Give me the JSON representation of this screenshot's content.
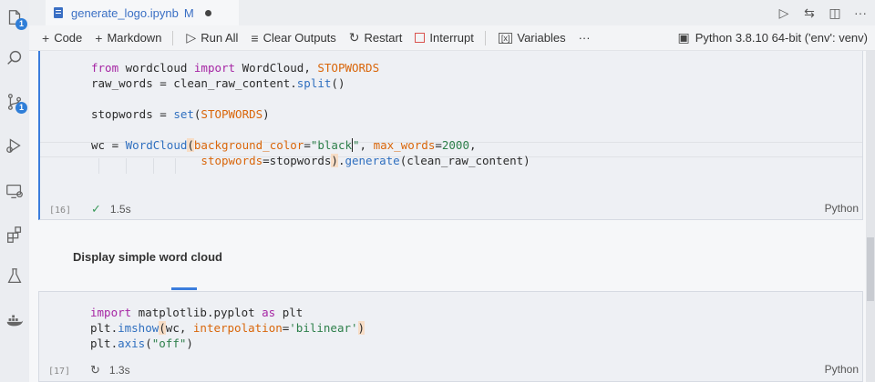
{
  "activity_bar": {
    "explorer_badge": "1",
    "source_control_badge": "1"
  },
  "tab": {
    "filename": "generate_logo.ipynb",
    "modified_flag": "M"
  },
  "toolbar": {
    "add_code": "Code",
    "add_markdown": "Markdown",
    "run_all": "Run All",
    "clear_outputs": "Clear Outputs",
    "restart": "Restart",
    "interrupt": "Interrupt",
    "variables": "Variables",
    "more": "···",
    "kernel": "Python 3.8.10 64-bit ('env': venv)"
  },
  "cell1": {
    "exec_count": "[16]",
    "duration": "1.5s",
    "language": "Python",
    "lines": [
      "from wordcloud import WordCloud, STOPWORDS",
      "raw_words = clean_raw_content.split()",
      "",
      "stopwords = set(STOPWORDS)",
      "",
      "wc = WordCloud(background_color=\"black\", max_words=2000,",
      "                stopwords=stopwords).generate(clean_raw_content)"
    ]
  },
  "markdown": {
    "heading": "Display simple word cloud"
  },
  "cell2": {
    "exec_count": "[17]",
    "duration": "1.3s",
    "language": "Python",
    "lines": [
      "import matplotlib.pyplot as plt",
      "plt.imshow(wc, interpolation='bilinear')",
      "plt.axis(\"off\")"
    ]
  },
  "colors": {
    "accent": "#3b7ddd",
    "keyword": "#a626a4",
    "constant": "#d9660a",
    "string": "#2d7f4a",
    "function": "#2f6fbf"
  }
}
